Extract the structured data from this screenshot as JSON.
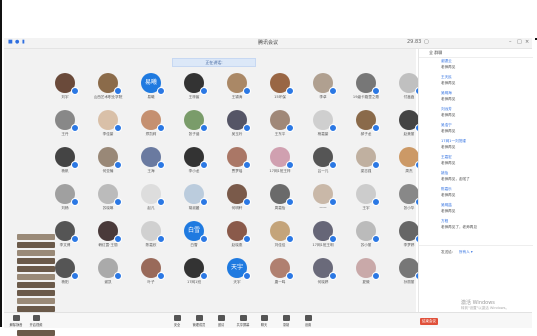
{
  "window": {
    "title": "腾讯会议"
  },
  "header": {
    "banner": "正在讲话:",
    "right_status": "29.83"
  },
  "chat": {
    "header_left": "全 群聊",
    "header_right": "",
    "messages": [
      {
        "name": "谢潇云",
        "text": "老师再见"
      },
      {
        "name": "王天民",
        "text": "老师再见"
      },
      {
        "name": "吴明海",
        "text": "老师再见"
      },
      {
        "name": "刘远芳",
        "text": "老师再见"
      },
      {
        "name": "吴浩宁",
        "text": "老师再见"
      },
      {
        "name": "17网1一刘茂瑾",
        "text": "老师再见"
      },
      {
        "name": "王嘉宏",
        "text": "老师再见"
      },
      {
        "name": "姚怡",
        "text": "老师再见，走啦了"
      },
      {
        "name": "陈嘉乐",
        "text": "老师再见"
      },
      {
        "name": "吴明喆",
        "text": "老师再见"
      },
      {
        "name": "方程",
        "text": "老师再见了，老师再见"
      }
    ],
    "footer_label": "发送给：",
    "footer_target": "所有人 ▾",
    "watermark_1": "激活 Windows",
    "watermark_2": "转到\"设置\"以激活 Windows。"
  },
  "participants": [
    {
      "name": "刘宇",
      "color": "#6a4a3a"
    },
    {
      "name": "山西艺术职业学院",
      "color": "#8b6b4a"
    },
    {
      "name": "易曦",
      "color": "#1f7ae0",
      "text": "易曦"
    },
    {
      "name": "王梓宸",
      "color": "#333"
    },
    {
      "name": "王锦涛",
      "color": "#aa8866"
    },
    {
      "name": "15环保",
      "color": "#996644"
    },
    {
      "name": "李卓",
      "color": "#b0a090"
    },
    {
      "name": "19级卡路里之歌",
      "color": "#777"
    },
    {
      "name": "付鑫鑫",
      "color": "#c0c0c0"
    },
    {
      "name": "王丹",
      "color": "#888"
    },
    {
      "name": "李佳豪",
      "color": "#d9c0a8"
    },
    {
      "name": "郑凯莉",
      "color": "#c59070"
    },
    {
      "name": "张子涵",
      "color": "#7a9c6a"
    },
    {
      "name": "吴玉玲",
      "color": "#556"
    },
    {
      "name": "王东平",
      "color": "#a08878"
    },
    {
      "name": "杨嘉豪",
      "color": "#cfcfcf"
    },
    {
      "name": "郝子龙",
      "color": "#8a6a4a"
    },
    {
      "name": "赵美丽",
      "color": "#444"
    },
    {
      "name": "杨帆",
      "color": "#444"
    },
    {
      "name": "何亚楠",
      "color": "#998877"
    },
    {
      "name": "王海",
      "color": "#6a7aa0"
    },
    {
      "name": "李小龙",
      "color": "#333"
    },
    {
      "name": "贾梦瑶",
      "color": "#aa7766"
    },
    {
      "name": "17网1班王梓",
      "color": "#d0a0b0"
    },
    {
      "name": "吕一凡",
      "color": "#555"
    },
    {
      "name": "梁志强",
      "color": "#c0b0a0"
    },
    {
      "name": "周杰",
      "color": "#cc9966"
    },
    {
      "name": "刘畅",
      "color": "#a0a0a0"
    },
    {
      "name": "苏晓琳",
      "color": "#bbbbbb"
    },
    {
      "name": "赵凡",
      "color": "#ddd",
      "text": ""
    },
    {
      "name": "胡淑媛",
      "color": "#bcd"
    },
    {
      "name": "何明轩",
      "color": "#7a5a4a"
    },
    {
      "name": "周嘉怡",
      "color": "#6a6a6a"
    },
    {
      "name": "一一",
      "color": "#c9b8a8"
    },
    {
      "name": "王宇",
      "color": "#ccc"
    },
    {
      "name": "张小华",
      "color": "#888"
    },
    {
      "name": "李文博",
      "color": "#555"
    },
    {
      "name": "韩红霞·王丽",
      "color": "#4a3a3a"
    },
    {
      "name": "陈嘉欣",
      "color": "#d0d0d0"
    },
    {
      "name": "白雪",
      "color": "#1f7ae0",
      "text": "白雪"
    },
    {
      "name": "赵晓燕",
      "color": "#8a5a4a"
    },
    {
      "name": "刘佳佳",
      "color": "#c4a47a"
    },
    {
      "name": "17网1班王明",
      "color": "#667"
    },
    {
      "name": "苏小丽",
      "color": "#bbb"
    },
    {
      "name": "李梦婷",
      "color": "#666"
    },
    {
      "name": "杨阳",
      "color": "#555"
    },
    {
      "name": "谢凯",
      "color": "#aaa"
    },
    {
      "name": "叶子",
      "color": "#996a5a"
    },
    {
      "name": "17网1班",
      "color": "#333"
    },
    {
      "name": "天宇",
      "color": "#1f7ae0",
      "text": "天宇"
    },
    {
      "name": "唐一鸣",
      "color": "#b08070"
    },
    {
      "name": "何晓婷",
      "color": "#6a6a7a"
    },
    {
      "name": "夏微",
      "color": "#c9a9a9"
    },
    {
      "name": "孙丽丽",
      "color": "#777"
    }
  ],
  "toolbar": {
    "items": [
      "解除静音",
      "开启视频",
      "安全",
      "管理成员",
      "邀请",
      "共享屏幕",
      "聊天",
      "录制",
      "设置"
    ],
    "end_label": "结束会议"
  }
}
